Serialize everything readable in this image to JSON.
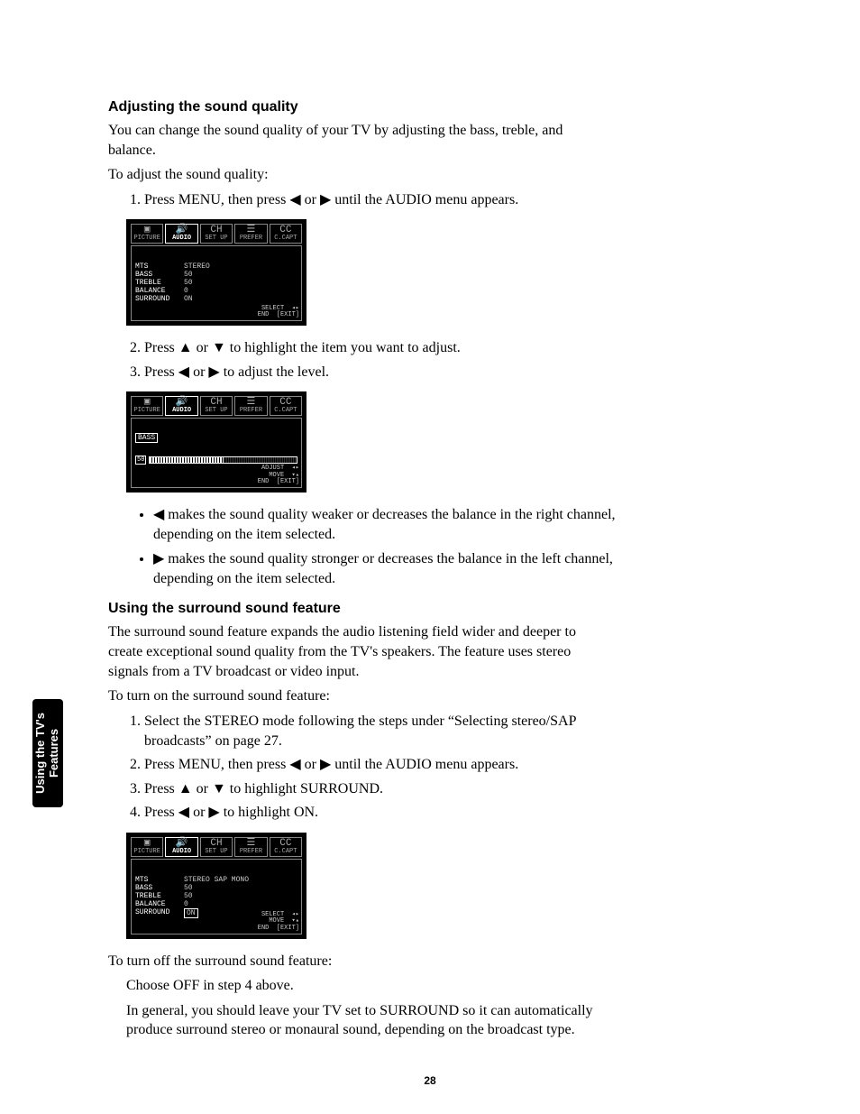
{
  "sidebar": {
    "line1": "Using the TV's",
    "line2": "Features"
  },
  "section1": {
    "heading": "Adjusting the sound quality",
    "intro": "You can change the sound quality of your TV by adjusting the bass, treble, and balance.",
    "lead": "To adjust the sound quality:",
    "steps": {
      "s1": "Press MENU, then press ◀ or ▶ until the AUDIO menu appears.",
      "s2": "Press ▲ or ▼ to highlight the item you want to adjust.",
      "s3": "Press ◀ or ▶ to adjust the level."
    },
    "bullets": {
      "b1": "◀ makes the sound quality weaker or decreases the balance in the right channel, depending on the item selected.",
      "b2": "▶ makes the sound quality stronger or decreases the balance in the left channel, depending on the item selected."
    }
  },
  "section2": {
    "heading": "Using the surround sound feature",
    "intro": "The surround sound feature expands the audio listening field wider and deeper to create exceptional sound quality from the TV's speakers. The feature uses stereo signals from a TV broadcast or video input.",
    "lead": "To turn on the surround sound feature:",
    "steps": {
      "s1": "Select the STEREO mode following the steps under “Selecting stereo/SAP broadcasts” on page 27.",
      "s2": "Press MENU, then press ◀ or ▶ until the AUDIO menu appears.",
      "s3": "Press ▲ or ▼ to highlight SURROUND.",
      "s4": "Press ◀ or ▶ to highlight ON."
    },
    "offLead": "To turn off the surround sound feature:",
    "off1": "Choose OFF in step 4 above.",
    "off2": "In general, you should leave your TV set to SURROUND so it can automatically produce surround stereo or monaural sound, depending on the broadcast type."
  },
  "osd": {
    "tabs": {
      "picture": "PICTURE",
      "audio": "AUDIO",
      "setup": "SET UP",
      "prefer": "PREFER",
      "ccapt": "C.CAPT",
      "cc_abbrev": "CC",
      "ch_abbrev": "CH"
    },
    "menu1": {
      "rows": {
        "mts": {
          "label": "MTS",
          "value": "STEREO"
        },
        "bass": {
          "label": "BASS",
          "value": "50"
        },
        "treble": {
          "label": "TREBLE",
          "value": "50"
        },
        "balance": {
          "label": "BALANCE",
          "value": "0"
        },
        "surround": {
          "label": "SURROUND",
          "value": "ON"
        }
      },
      "hint1": "SELECT",
      "hint2": "END",
      "hint3": "[EXIT]"
    },
    "slider": {
      "label": "BASS",
      "value": "50",
      "hint1": "ADJUST",
      "hint2": "MOVE",
      "hint3": "END",
      "hint4": "[EXIT]"
    },
    "menu3": {
      "rows": {
        "mts": {
          "label": "MTS",
          "value": "STEREO  SAP  MONO"
        },
        "bass": {
          "label": "BASS",
          "value": "50"
        },
        "treble": {
          "label": "TREBLE",
          "value": "50"
        },
        "balance": {
          "label": "BALANCE",
          "value": "0"
        },
        "surround": {
          "label": "SURROUND",
          "value": "ON"
        }
      },
      "hint1": "SELECT",
      "hint2": "MOVE",
      "hint3": "END",
      "hint4": "[EXIT]"
    }
  },
  "pageNumber": "28"
}
